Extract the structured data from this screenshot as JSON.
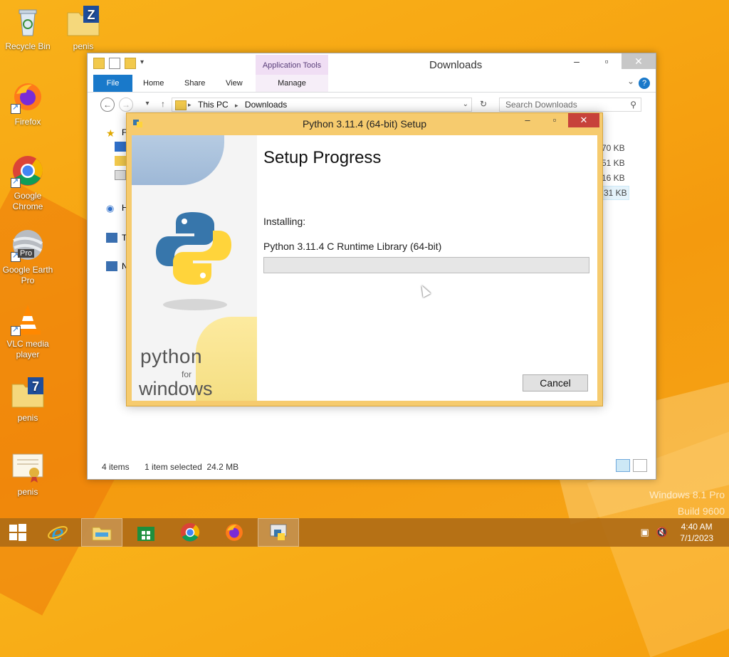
{
  "desktop": {
    "icons": [
      {
        "label": "Recycle Bin",
        "icon": "recycle-bin-icon"
      },
      {
        "label": "penis",
        "icon": "zip-folder-icon"
      },
      {
        "label": "Firefox",
        "icon": "firefox-icon"
      },
      {
        "label": "Google Chrome",
        "icon": "chrome-icon"
      },
      {
        "label": "Google Earth Pro",
        "icon": "google-earth-icon"
      },
      {
        "label": "VLC media player",
        "icon": "vlc-icon"
      },
      {
        "label": "penis",
        "icon": "7zip-folder-icon"
      },
      {
        "label": "penis",
        "icon": "certificate-icon"
      }
    ],
    "earth_badge": "Pro",
    "watermark": {
      "line1": "Windows 8.1 Pro",
      "line2": "Build 9600"
    }
  },
  "explorer": {
    "title": "Downloads",
    "context_tab_header": "Application Tools",
    "tabs": {
      "file": "File",
      "home": "Home",
      "share": "Share",
      "view": "View",
      "manage": "Manage"
    },
    "path": {
      "root": "This PC",
      "current": "Downloads"
    },
    "search_placeholder": "Search Downloads",
    "nav_fragments": [
      "F",
      "H",
      "T",
      "N"
    ],
    "file_sizes": [
      "70 KB",
      "51 KB",
      "16 KB",
      "31 KB"
    ],
    "status": {
      "items": "4 items",
      "selected": "1 item selected  24.2 MB"
    }
  },
  "setup": {
    "title": "Python 3.11.4 (64-bit) Setup",
    "heading": "Setup Progress",
    "installing_label": "Installing:",
    "component": "Python 3.11.4 C Runtime Library (64-bit)",
    "progress_fraction": 0,
    "cancel_label": "Cancel",
    "art": {
      "python": "python",
      "for": "for",
      "windows": "windows"
    }
  },
  "taskbar": {
    "pinned": [
      "windows-start-icon",
      "internet-explorer-icon",
      "file-explorer-icon",
      "store-icon",
      "chrome-icon",
      "firefox-icon",
      "python-installer-icon"
    ],
    "clock": {
      "time": "4:40 AM",
      "date": "7/1/2023"
    }
  }
}
